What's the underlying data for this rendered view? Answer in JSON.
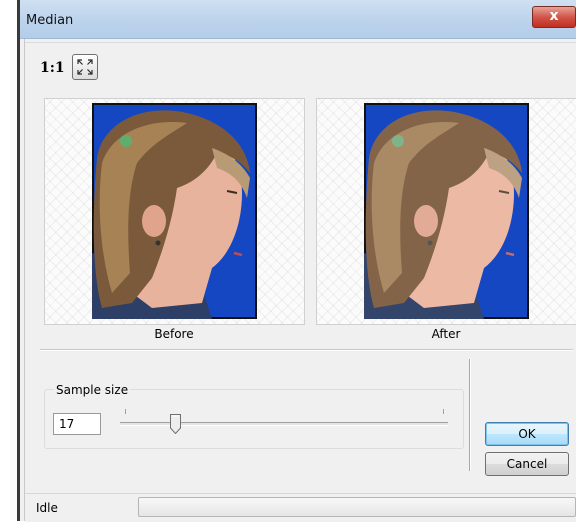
{
  "window": {
    "title": "Median",
    "close_glyph": "x"
  },
  "toolbar": {
    "zoom_label": "1:1",
    "fit_icon": "fit-to-window-icon"
  },
  "preview": {
    "before_caption": "Before",
    "after_caption": "After"
  },
  "sample": {
    "group_label": "Sample size",
    "value": "17",
    "slider_fraction": 0.17
  },
  "buttons": {
    "ok": "OK",
    "cancel": "Cancel"
  },
  "status": {
    "text": "Idle",
    "progress": 0
  },
  "colors": {
    "photo_background": "#1a4cc8",
    "ok_border": "#3c7fb1",
    "close_red": "#c7392c"
  }
}
